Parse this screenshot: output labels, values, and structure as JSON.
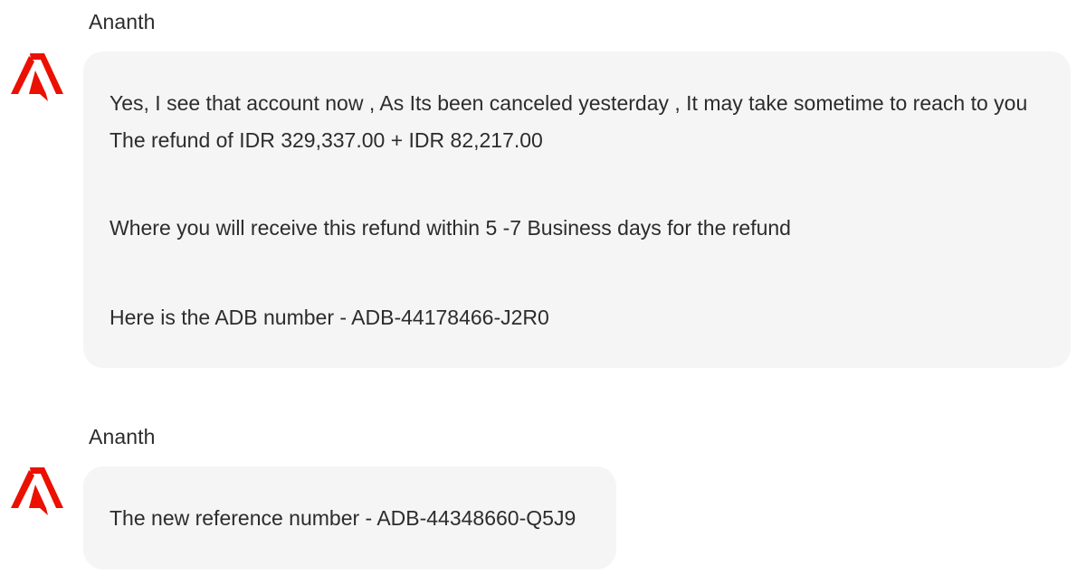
{
  "brand_color": "#eb1000",
  "messages": [
    {
      "sender": "Ananth",
      "avatar_icon": "adobe-logo-icon",
      "lines": [
        "Yes, I see that account now , As Its been canceled yesterday , It may take sometime to reach to you",
        "The refund of IDR 329,337.00 + IDR 82,217.00",
        "Where you will receive this refund within 5 -7 Business days for the refund",
        "Here is the ADB number - ADB-44178466-J2R0"
      ]
    },
    {
      "sender": "Ananth",
      "avatar_icon": "adobe-logo-icon",
      "lines": [
        "The new reference number - ADB-44348660-Q5J9"
      ]
    }
  ]
}
